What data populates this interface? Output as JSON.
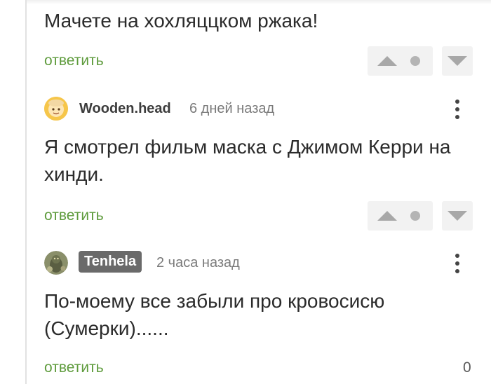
{
  "comments": [
    {
      "text": "Мачете на хохляццком ржака!",
      "reply_label": "ответить"
    },
    {
      "author": "Wooden.head",
      "time": "6 дней назад",
      "text": "Я смотрел фильм маска с Джимом Керри на хинди.",
      "reply_label": "ответить"
    },
    {
      "author": "Tenhela",
      "time": "2 часа назад",
      "text": "По-моему все забыли про кровосисю (Сумерки)......",
      "reply_label": "ответить",
      "score": "0"
    }
  ],
  "icons": {
    "upvote": "triangle-up-icon",
    "neutral": "dot-icon",
    "downvote": "triangle-down-icon",
    "menu": "kebab-menu-icon"
  },
  "colors": {
    "reply_link": "#5e9b3c",
    "badge_bg": "#6a6a6a",
    "vote_bg": "#f2f2f2"
  }
}
